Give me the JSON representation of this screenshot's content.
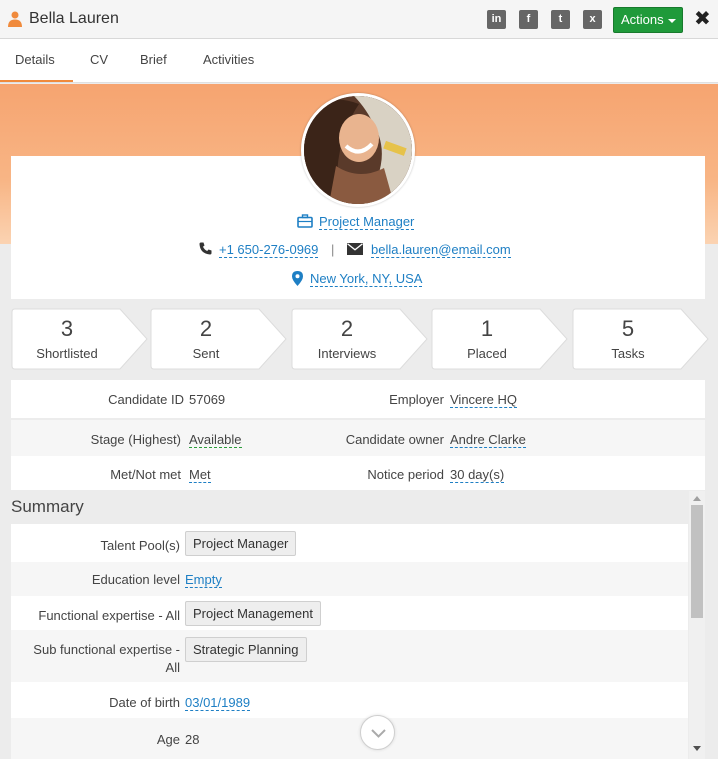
{
  "header": {
    "title": "Bella Lauren",
    "social": [
      {
        "name": "linkedin-icon",
        "glyph": "in"
      },
      {
        "name": "facebook-icon",
        "glyph": "f"
      },
      {
        "name": "twitter-icon",
        "glyph": "t"
      },
      {
        "name": "xing-icon",
        "glyph": "x"
      }
    ],
    "actions_label": "Actions",
    "close_glyph": "✖"
  },
  "tabs": [
    "Details",
    "CV",
    "Brief",
    "Activities"
  ],
  "active_tab": "Details",
  "profile": {
    "job_title": "Project Manager",
    "phone": "+1 650-276-0969",
    "separator": "|",
    "email": "bella.lauren@email.com",
    "location": "New York, NY, USA"
  },
  "stats": [
    {
      "value": "3",
      "label": "Shortlisted"
    },
    {
      "value": "2",
      "label": "Sent"
    },
    {
      "value": "2",
      "label": "Interviews"
    },
    {
      "value": "1",
      "label": "Placed"
    },
    {
      "value": "5",
      "label": "Tasks"
    }
  ],
  "details": {
    "candidate_id_label": "Candidate ID",
    "candidate_id": "57069",
    "employer_label": "Employer",
    "employer": "Vincere HQ",
    "stage_label": "Stage (Highest)",
    "stage": "Available",
    "owner_label": "Candidate owner",
    "owner": "Andre Clarke",
    "met_label": "Met/Not met",
    "met": "Met",
    "notice_label": "Notice period",
    "notice": "30 day(s)"
  },
  "summary": {
    "title": "Summary",
    "talent_pools_label": "Talent Pool(s)",
    "talent_pools": "Project Manager",
    "education_label": "Education level",
    "education": "Empty",
    "functional_label": "Functional expertise - All",
    "functional": "Project Management",
    "sub_functional_label_1": "Sub functional expertise -",
    "sub_functional_label_2": "All",
    "sub_functional": "Strategic Planning",
    "dob_label": "Date of birth",
    "dob": "03/01/1989",
    "age_label": "Age",
    "age": "28"
  },
  "colors": {
    "accent_orange": "#f08a3c",
    "action_green": "#1f9a3a",
    "link_blue": "#1e7fc4",
    "status_green": "#2a9d3a"
  }
}
